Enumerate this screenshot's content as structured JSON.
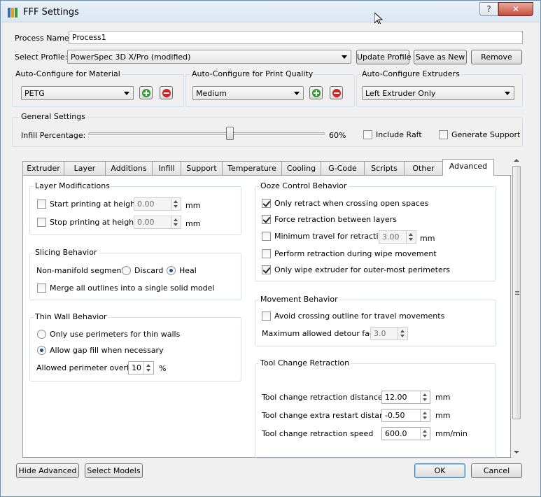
{
  "window": {
    "title": "FFF Settings",
    "help_label": "?",
    "close_label": "✕"
  },
  "process": {
    "name_label": "Process Name:",
    "name_value": "Process1"
  },
  "profile": {
    "label": "Select Profile:",
    "value": "PowerSpec 3D X/Pro (modified)",
    "update_label": "Update Profile",
    "save_label": "Save as New",
    "remove_label": "Remove"
  },
  "material": {
    "title": "Auto-Configure for Material",
    "value": "PETG"
  },
  "quality": {
    "title": "Auto-Configure for Print Quality",
    "value": "Medium"
  },
  "extruders": {
    "title": "Auto-Configure Extruders",
    "value": "Left Extruder Only"
  },
  "general": {
    "title": "General Settings",
    "infill_label": "Infill Percentage:",
    "infill_value_text": "60%",
    "infill_value": 60,
    "raft_label": "Include Raft",
    "raft_checked": false,
    "support_label": "Generate Support",
    "support_checked": false
  },
  "tabs": [
    {
      "label": "Extruder"
    },
    {
      "label": "Layer"
    },
    {
      "label": "Additions"
    },
    {
      "label": "Infill"
    },
    {
      "label": "Support"
    },
    {
      "label": "Temperature"
    },
    {
      "label": "Cooling"
    },
    {
      "label": "G-Code"
    },
    {
      "label": "Scripts"
    },
    {
      "label": "Other"
    },
    {
      "label": "Advanced"
    }
  ],
  "layer_mod": {
    "title": "Layer Modifications",
    "start_label": "Start printing at height",
    "start_value": "0.00",
    "stop_label": "Stop printing at height",
    "stop_value": "0.00",
    "unit": "mm"
  },
  "slicing": {
    "title": "Slicing Behavior",
    "nonmanifold_label": "Non-manifold segments:",
    "discard_label": "Discard",
    "heal_label": "Heal",
    "merge_label": "Merge all outlines into a single solid model"
  },
  "thinwall": {
    "title": "Thin Wall Behavior",
    "opt1_label": "Only use perimeters for thin walls",
    "opt2_label": "Allow gap fill when necessary",
    "overlap_label": "Allowed perimeter overlap",
    "overlap_value": "10",
    "overlap_unit": "%"
  },
  "ooze": {
    "title": "Ooze Control Behavior",
    "only_retract_label": "Only retract when crossing open spaces",
    "force_label": "Force retraction between layers",
    "min_travel_label": "Minimum travel for retraction",
    "min_travel_value": "3.00",
    "min_travel_unit": "mm",
    "wipe_label": "Perform retraction during wipe movement",
    "outer_label": "Only wipe extruder for outer-most perimeters"
  },
  "movement": {
    "title": "Movement Behavior",
    "avoid_label": "Avoid crossing outline for travel movements",
    "detour_label": "Maximum allowed detour factor",
    "detour_value": "3.0"
  },
  "toolchange": {
    "title": "Tool Change Retraction",
    "dist_label": "Tool change retraction distance",
    "dist_value": "12.00",
    "dist_unit": "mm",
    "extra_label": "Tool change extra restart distance",
    "extra_value": "-0.50",
    "extra_unit": "mm",
    "speed_label": "Tool change retraction speed",
    "speed_value": "600.0",
    "speed_unit": "mm/min"
  },
  "footer": {
    "hide_label": "Hide Advanced",
    "select_label": "Select Models",
    "ok_label": "OK",
    "cancel_label": "Cancel"
  }
}
